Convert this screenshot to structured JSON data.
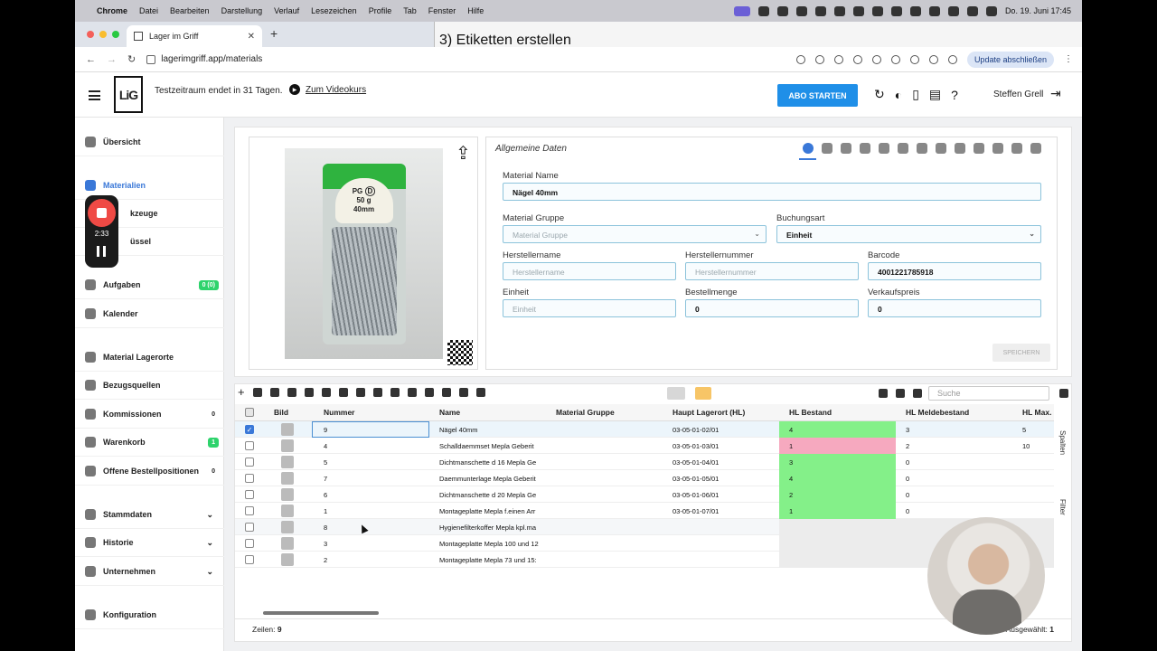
{
  "os_menubar": {
    "app": "Chrome",
    "menus": [
      "Datei",
      "Bearbeiten",
      "Darstellung",
      "Verlauf",
      "Lesezeichen",
      "Profile",
      "Tab",
      "Fenster",
      "Hilfe"
    ],
    "clock": "Do. 19. Juni  17:45"
  },
  "browser": {
    "tab_title": "Lager im Griff",
    "url": "lagerimgriff.app/materials",
    "update_button": "Update abschließen"
  },
  "overlay_title": "3) Etiketten erstellen",
  "header": {
    "logo_text": "LiG",
    "trial_text": "Testzeitraum endet in 31 Tagen.",
    "videokurs_label": "Zum Videokurs",
    "abo_button": "ABO STARTEN",
    "username": "Steffen Grell"
  },
  "recorder": {
    "time": "2:33"
  },
  "sidebar": {
    "items": [
      {
        "label": "Übersicht"
      },
      {
        "label": "Materialien"
      },
      {
        "label": "Werkzeuge"
      },
      {
        "label": "Schlüssel"
      },
      {
        "label": "Aufgaben",
        "badge": "0 (0)"
      },
      {
        "label": "Kalender"
      },
      {
        "label": "Material Lagerorte"
      },
      {
        "label": "Bezugsquellen"
      },
      {
        "label": "Kommissionen",
        "badge": "0"
      },
      {
        "label": "Warenkorb",
        "badge": "1"
      },
      {
        "label": "Offene Bestellpositionen",
        "badge": "0"
      },
      {
        "label": "Stammdaten"
      },
      {
        "label": "Historie"
      },
      {
        "label": "Unternehmen"
      },
      {
        "label": "Konfiguration"
      }
    ],
    "visible_labels": {
      "werkzeuge": "kzeuge",
      "schluessel": "üssel"
    }
  },
  "product_image": {
    "label_line1": "PG",
    "label_line2": "D",
    "label_line3": "50 g",
    "label_line4": "40mm"
  },
  "form": {
    "title": "Allgemeine Daten",
    "material_name": {
      "label": "Material Name",
      "value": "Nägel 40mm"
    },
    "material_gruppe": {
      "label": "Material Gruppe",
      "placeholder": "Material Gruppe"
    },
    "buchungsart": {
      "label": "Buchungsart",
      "value": "Einheit"
    },
    "herstellername": {
      "label": "Herstellername",
      "placeholder": "Herstellername"
    },
    "herstellernummer": {
      "label": "Herstellernummer",
      "placeholder": "Herstellernummer"
    },
    "barcode": {
      "label": "Barcode",
      "value": "4001221785918"
    },
    "einheit": {
      "label": "Einheit",
      "placeholder": "Einheit"
    },
    "bestellmenge": {
      "label": "Bestellmenge",
      "value": "0"
    },
    "verkaufspreis": {
      "label": "Verkaufspreis",
      "value": "0"
    },
    "save_button": "SPEICHERN"
  },
  "table": {
    "search_placeholder": "Suche",
    "columns": [
      "Bild",
      "Nummer",
      "Name",
      "Material Gruppe",
      "Haupt Lagerort (HL)",
      "HL Bestand",
      "HL Meldebestand",
      "HL Max."
    ],
    "rows": [
      {
        "nummer": "9",
        "name": "Nägel 40mm",
        "gruppe": "",
        "lagerort": "03-05-01-02/01",
        "bestand": "4",
        "melde": "3",
        "max": "5",
        "status": "green",
        "checked": true
      },
      {
        "nummer": "4",
        "name": "Schalldaemmset Mepla Geberit",
        "gruppe": "",
        "lagerort": "03-05-01-03/01",
        "bestand": "1",
        "melde": "2",
        "max": "10",
        "status": "red",
        "checked": false
      },
      {
        "nummer": "5",
        "name": "Dichtmanschette d 16 Mepla Ge",
        "gruppe": "",
        "lagerort": "03-05-01-04/01",
        "bestand": "3",
        "melde": "0",
        "max": "",
        "status": "green",
        "checked": false
      },
      {
        "nummer": "7",
        "name": "Daemmunterlage Mepla Geberit",
        "gruppe": "",
        "lagerort": "03-05-01-05/01",
        "bestand": "4",
        "melde": "0",
        "max": "",
        "status": "green",
        "checked": false
      },
      {
        "nummer": "6",
        "name": "Dichtmanschette d 20 Mepla Ge",
        "gruppe": "",
        "lagerort": "03-05-01-06/01",
        "bestand": "2",
        "melde": "0",
        "max": "",
        "status": "green",
        "checked": false
      },
      {
        "nummer": "1",
        "name": "Montageplatte Mepla f.einen Arr",
        "gruppe": "",
        "lagerort": "03-05-01-07/01",
        "bestand": "1",
        "melde": "0",
        "max": "",
        "status": "green",
        "checked": false
      },
      {
        "nummer": "8",
        "name": "Hygienefilterkoffer Mepla kpl.ma",
        "gruppe": "",
        "lagerort": "",
        "bestand": "",
        "melde": "",
        "max": "",
        "status": "empty",
        "checked": false
      },
      {
        "nummer": "3",
        "name": "Montageplatte Mepla 100 und 12",
        "gruppe": "",
        "lagerort": "",
        "bestand": "",
        "melde": "",
        "max": "",
        "status": "empty",
        "checked": false
      },
      {
        "nummer": "2",
        "name": "Montageplatte Mepla 73 und 15:",
        "gruppe": "",
        "lagerort": "",
        "bestand": "",
        "melde": "",
        "max": "",
        "status": "empty",
        "checked": false
      }
    ],
    "side_spalten": "Spalten",
    "side_filter": "Filter",
    "footer_rows_label": "Zeilen:",
    "footer_rows_value": "9",
    "footer_selected_label": "Ausgewählt:",
    "footer_selected_value": "1"
  }
}
